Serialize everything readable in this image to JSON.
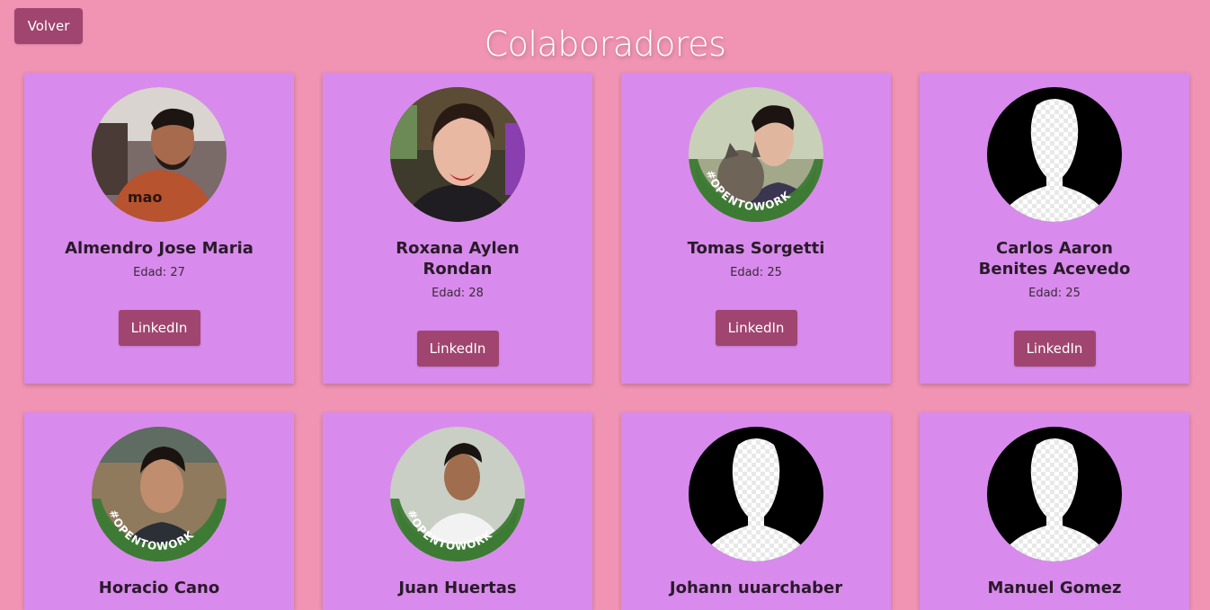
{
  "header": {
    "back_label": "Volver",
    "title": "Colaboradores"
  },
  "colors": {
    "background": "#f194b4",
    "card": "#d88bec",
    "button": "#a0456f"
  },
  "collaborators": [
    {
      "name": "Almendro Jose Maria",
      "age": "Edad: 27",
      "button": "LinkedIn",
      "avatar": "photo"
    },
    {
      "name": "Roxana Aylen Rondan",
      "age": "Edad: 28",
      "button": "LinkedIn",
      "avatar": "photo"
    },
    {
      "name": "Tomas Sorgetti",
      "age": "Edad: 25",
      "button": "LinkedIn",
      "avatar": "photo-opentowork",
      "badge": "#OPENTOWORK"
    },
    {
      "name": "Carlos Aaron Benites Acevedo",
      "age": "Edad: 25",
      "button": "LinkedIn",
      "avatar": "default-silhouette"
    },
    {
      "name": "Horacio Cano",
      "avatar": "photo-opentowork",
      "badge": "#OPENTOWORK"
    },
    {
      "name": "Juan Huertas",
      "avatar": "photo-opentowork",
      "badge": "#OPENTOWORK"
    },
    {
      "name": "Johann uuarchaber",
      "avatar": "default-silhouette"
    },
    {
      "name": "Manuel Gomez",
      "avatar": "default-silhouette"
    }
  ]
}
